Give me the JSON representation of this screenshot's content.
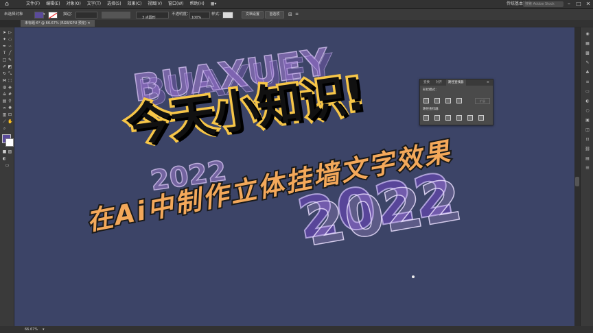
{
  "menubar": {
    "items": [
      "文件(F)",
      "编辑(E)",
      "对象(O)",
      "文字(T)",
      "选择(S)",
      "效果(C)",
      "视图(V)",
      "窗口(W)",
      "帮助(H)"
    ],
    "workspace": "传统基本功能",
    "search_placeholder": "搜索 Adobe Stock"
  },
  "controlbar": {
    "selection_label": "未选择对象",
    "stroke_label": "描边：",
    "brush_value": "3 点圆形",
    "opacity_label": "不透明度：",
    "opacity_value": "100%",
    "style_label": "样式：",
    "doc_setup": "文档设置",
    "preferences": "首选项"
  },
  "document": {
    "tab_title": "未标题-6* @ 66.67% (RGB/GPU 预览)",
    "zoom": "66.67%"
  },
  "pathfinder": {
    "tabs": [
      "变换",
      "对齐",
      "路径查找器"
    ],
    "shape_modes": "形状模式：",
    "pathfinders": "路径查找器：",
    "expand": "扩展"
  },
  "artwork": {
    "title": "今天小知识!",
    "subtitle": "在Ai中制作立体挂墙文字效果",
    "ghost_text": "BUAXUEY",
    "ghost_year": "2022",
    "colors": {
      "canvas": "#3c4467",
      "title_fill": "#111111",
      "title_stroke": "#f7c648",
      "subtitle": "#f3a85a",
      "ghost": "#a882d8"
    }
  }
}
